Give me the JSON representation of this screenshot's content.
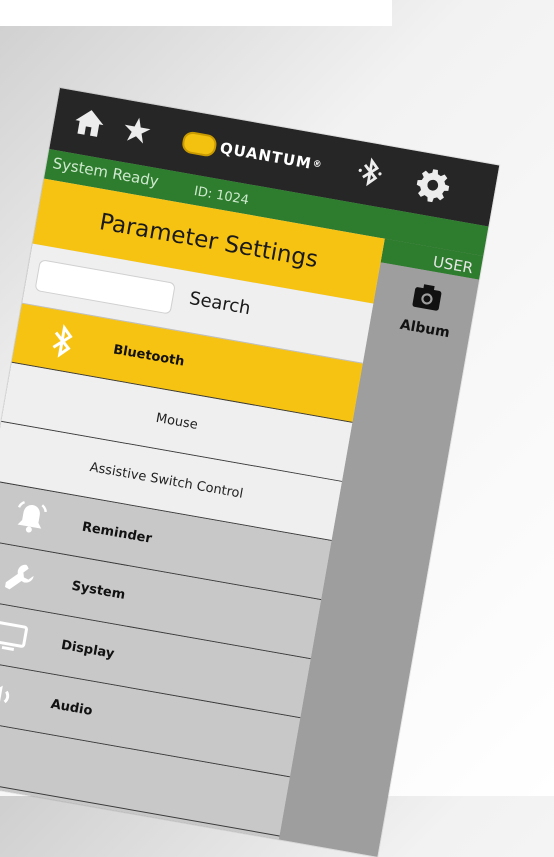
{
  "app": {
    "logo_text": "QUANTUM",
    "logo_mark": "®"
  },
  "status": {
    "text": "System Ready",
    "device_id": "ID: 1024",
    "user": "USER"
  },
  "drawer": {
    "title": "Parameter Settings",
    "search_placeholder": "",
    "search_label": "Search",
    "items": [
      {
        "label": "Bluetooth",
        "icon": "bluetooth-icon",
        "active": true
      },
      {
        "label": "Reminder",
        "icon": "bell-icon",
        "active": false
      },
      {
        "label": "System",
        "icon": "wrench-icon",
        "active": false
      },
      {
        "label": "Display",
        "icon": "monitor-icon",
        "active": false
      },
      {
        "label": "Audio",
        "icon": "speaker-icon",
        "active": false
      }
    ],
    "subitems": [
      {
        "label": "Mouse"
      },
      {
        "label": "Assistive Switch Control"
      }
    ]
  },
  "side_panel": {
    "album_label": "Album"
  },
  "colors": {
    "accent_yellow": "#f7c313",
    "status_green": "#2e7d2e",
    "topbar_dark": "#262626",
    "menu_gray": "#c8c8c8"
  }
}
